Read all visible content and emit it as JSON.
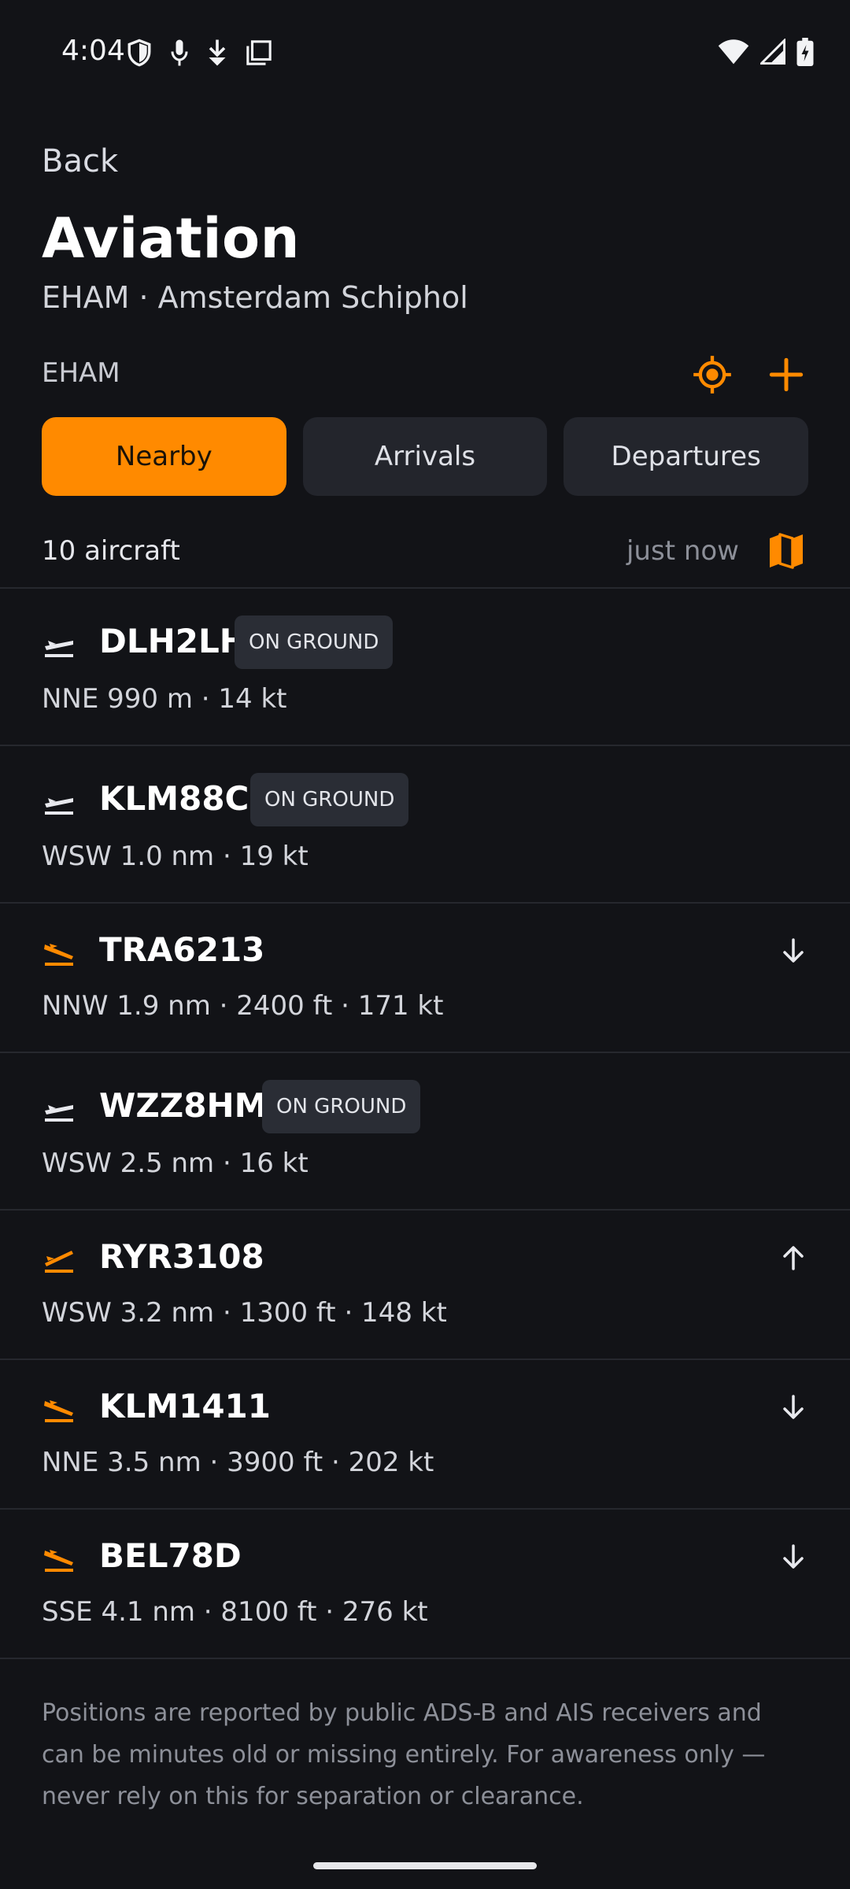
{
  "status_bar": {
    "time": "4:04",
    "left_icons": [
      "shield-icon",
      "microphone-icon",
      "download-icon",
      "screen-icon"
    ],
    "right_icons": [
      "wifi-icon",
      "cellular-icon",
      "battery-icon"
    ]
  },
  "header": {
    "back_label": "Back",
    "title": "Aviation",
    "subtitle": "EHAM · Amsterdam Schiphol"
  },
  "station": {
    "code": "EHAM",
    "actions": [
      "locate-icon",
      "add-icon"
    ]
  },
  "tabs": [
    {
      "label": "Nearby",
      "active": true
    },
    {
      "label": "Arrivals",
      "active": false
    },
    {
      "label": "Departures",
      "active": false
    }
  ],
  "summary": {
    "count_label": "10 aircraft",
    "updated_label": "just now",
    "map_icon": "map-icon"
  },
  "aircraft": [
    {
      "callsign": "DLH2LH",
      "details": "NNE 990 m  ·  14 kt",
      "status": "ON GROUND",
      "trend": ""
    },
    {
      "callsign": "KLM88C",
      "details": "WSW 1.0 nm  ·  19 kt",
      "status": "ON GROUND",
      "trend": ""
    },
    {
      "callsign": "TRA6213",
      "details": "NNW 1.9 nm  ·  2400 ft  ·  171 kt",
      "status": "",
      "trend": "descending"
    },
    {
      "callsign": "WZZ8HM",
      "details": "WSW 2.5 nm  ·  16 kt",
      "status": "ON GROUND",
      "trend": ""
    },
    {
      "callsign": "RYR3108",
      "details": "WSW 3.2 nm  ·  1300 ft  ·  148 kt",
      "status": "",
      "trend": "climbing"
    },
    {
      "callsign": "KLM1411",
      "details": "NNE 3.5 nm  ·  3900 ft  ·  202 kt",
      "status": "",
      "trend": "descending"
    },
    {
      "callsign": "BEL78D",
      "details": "SSE 4.1 nm  ·  8100 ft  ·  276 kt",
      "status": "",
      "trend": "descending"
    }
  ],
  "disclaimer": "Positions are reported by public ADS-B and AIS receivers and can be minutes old or missing entirely. For awareness only — never rely on this for separation or clearance.",
  "colors": {
    "accent": "#ff8a00",
    "background": "#121317",
    "surface": "#23252c",
    "ground_icon": "#e8e9ee",
    "airborne_icon": "#ff8a00"
  }
}
